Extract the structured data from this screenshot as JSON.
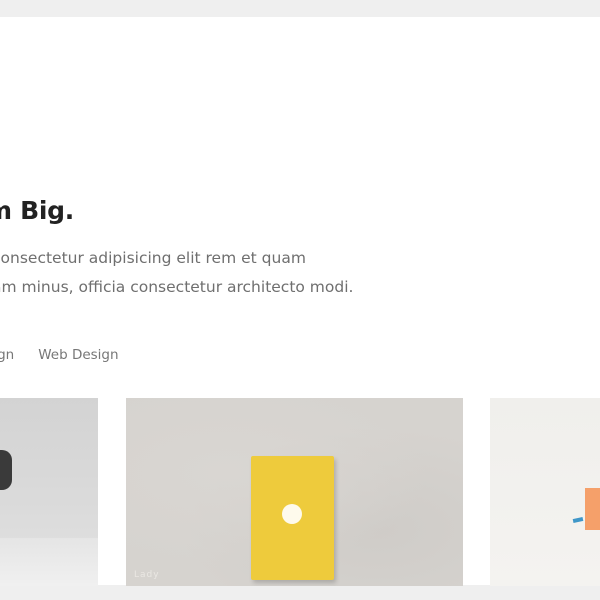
{
  "hero": {
    "title": "m Big.",
    "description_line1": "consectetur adipisicing elit rem et quam",
    "description_line2": "am minus, officia consectetur architecto modi."
  },
  "filters": [
    {
      "label": "esign"
    },
    {
      "label": "Web Design"
    }
  ],
  "portfolio": {
    "items": [
      {
        "name": "portfolio-item-1"
      },
      {
        "name": "portfolio-item-2",
        "watermark": "Lady"
      },
      {
        "name": "portfolio-item-3"
      }
    ]
  },
  "colors": {
    "page_bg": "#efefef",
    "content_bg": "#ffffff",
    "title": "#222222",
    "text": "#6f6f6f",
    "book": "#eecb3c",
    "accent_orange": "#f5a06a",
    "accent_blue": "#3f97c8"
  }
}
